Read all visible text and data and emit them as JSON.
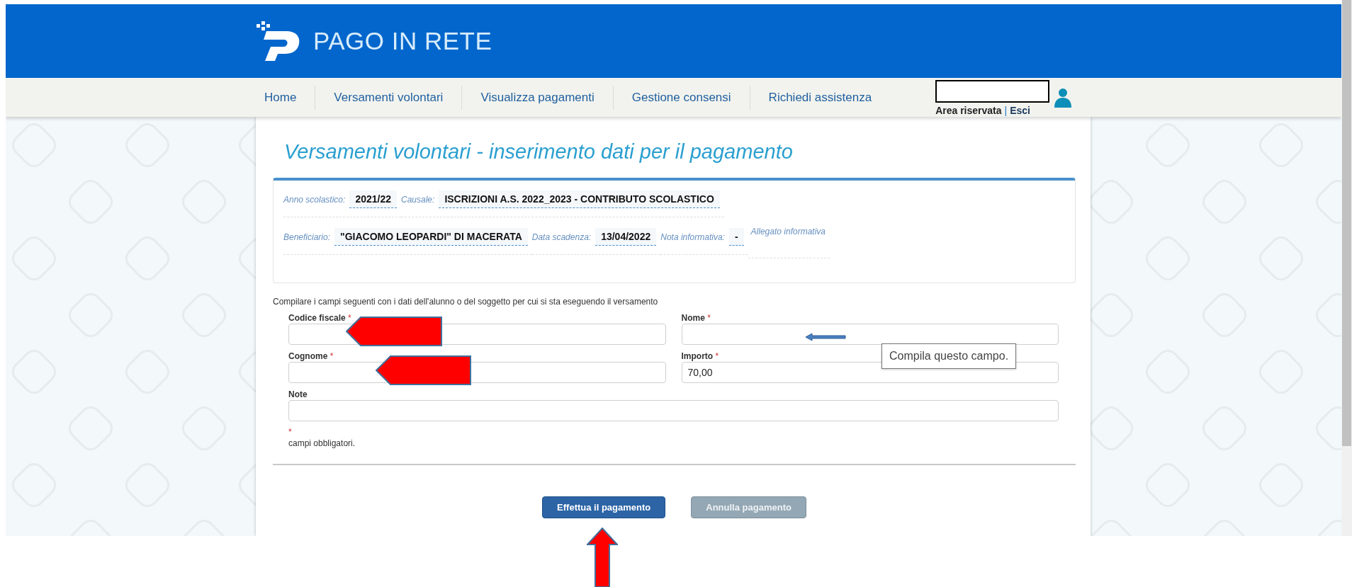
{
  "header": {
    "brand": "PAGO IN RETE"
  },
  "nav": {
    "items": [
      {
        "label": "Home"
      },
      {
        "label": "Versamenti volontari"
      },
      {
        "label": "Visualizza pagamenti"
      },
      {
        "label": "Gestione consensi"
      },
      {
        "label": "Richiedi assistenza"
      }
    ],
    "user": {
      "area": "Area riservata",
      "separator": "|",
      "logout": "Esci"
    }
  },
  "title": "Versamenti volontari - inserimento dati per il pagamento",
  "info": [
    [
      {
        "kind": "field",
        "label": "Anno scolastico:",
        "value": "2021/22"
      },
      {
        "kind": "field",
        "label": "Causale:",
        "value": "ISCRIZIONI A.S. 2022_2023 - CONTRIBUTO SCOLASTICO"
      }
    ],
    [
      {
        "kind": "field",
        "label": "Beneficiario:",
        "value": "\"GIACOMO LEOPARDI\" DI MACERATA"
      },
      {
        "kind": "field",
        "label": "Data scadenza:",
        "value": "13/04/2022"
      },
      {
        "kind": "field",
        "label": "Nota informativa:",
        "value": "-"
      },
      {
        "kind": "link",
        "label": "Allegato informativa"
      }
    ]
  ],
  "form": {
    "intro": "Compilare i campi seguenti con i dati dell'alunno o del soggetto per cui si sta eseguendo il versamento",
    "fields": [
      {
        "label": "Codice fiscale",
        "mark": "*",
        "wide": false
      },
      {
        "label": "Nome",
        "mark": "*",
        "wide": false
      },
      {
        "label": "Cognome",
        "mark": "*",
        "wide": false
      },
      {
        "label": "Importo",
        "mark": "*",
        "value": "70,00",
        "wide": false
      },
      {
        "label": "Note",
        "wide": true
      }
    ],
    "legend": {
      "mark": "*",
      "text": "campi obbligatori."
    },
    "tooltip": "Compila questo campo."
  },
  "buttons": [
    {
      "label": "Effettua il pagamento",
      "disabled": false
    },
    {
      "label": "Annulla pagamento",
      "disabled": true
    }
  ]
}
